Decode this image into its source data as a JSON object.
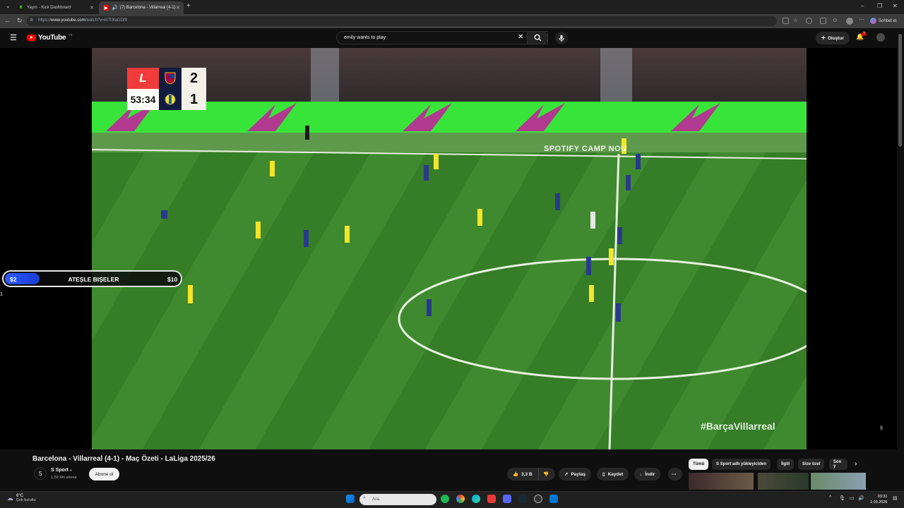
{
  "browser": {
    "tabs": [
      {
        "title": "Yayın - Kick Dashboard",
        "icon": "kick-icon",
        "active": false
      },
      {
        "title": "(7) Barcelona - Villarreal (4-1)",
        "icon": "youtube-icon",
        "active": true
      }
    ],
    "url_prefix": "https://",
    "url_domain": "www.youtube.com",
    "url_path": "/watch?v=kI7I3taGDf8",
    "profile_label": "Sohbet et"
  },
  "youtube": {
    "logo_text": "YouTube",
    "logo_region": "TR",
    "search_value": "emily wants to play",
    "create_label": "Oluştur",
    "notification_count": "7"
  },
  "video": {
    "scoreboard": {
      "league_logo": "L",
      "home_score": "2",
      "away_score": "1",
      "clock": "53:34"
    },
    "stadium_sign": "SPOTIFY CAMP NOU",
    "hashtag": "#BarçaVillarreal"
  },
  "overlay": {
    "left_value": "$2",
    "label": "ATEŞLE BIŞELER",
    "right_value": "$10",
    "progress": 0.2,
    "side_number": "1"
  },
  "video_info": {
    "title": "Barcelona - Villarreal (4-1) - Maç Özeti - LaLiga 2025/26",
    "channel_name": "S Sport",
    "subscribers": "1,59 Mn abone",
    "subscribe_label": "Abone ol",
    "like_count": "3,3 B",
    "share_label": "Paylaş",
    "save_label": "Kaydet",
    "download_label": "İndir"
  },
  "chips": [
    "Tümü",
    "S Sport adlı yükleyiciden",
    "İlgili",
    "Size özel",
    "Son y"
  ],
  "taskbar": {
    "weather_temp": "6°C",
    "weather_cond": "Çok bulutlu",
    "search_placeholder": "Ara",
    "time": "03:31",
    "date": "1.03.2026"
  }
}
